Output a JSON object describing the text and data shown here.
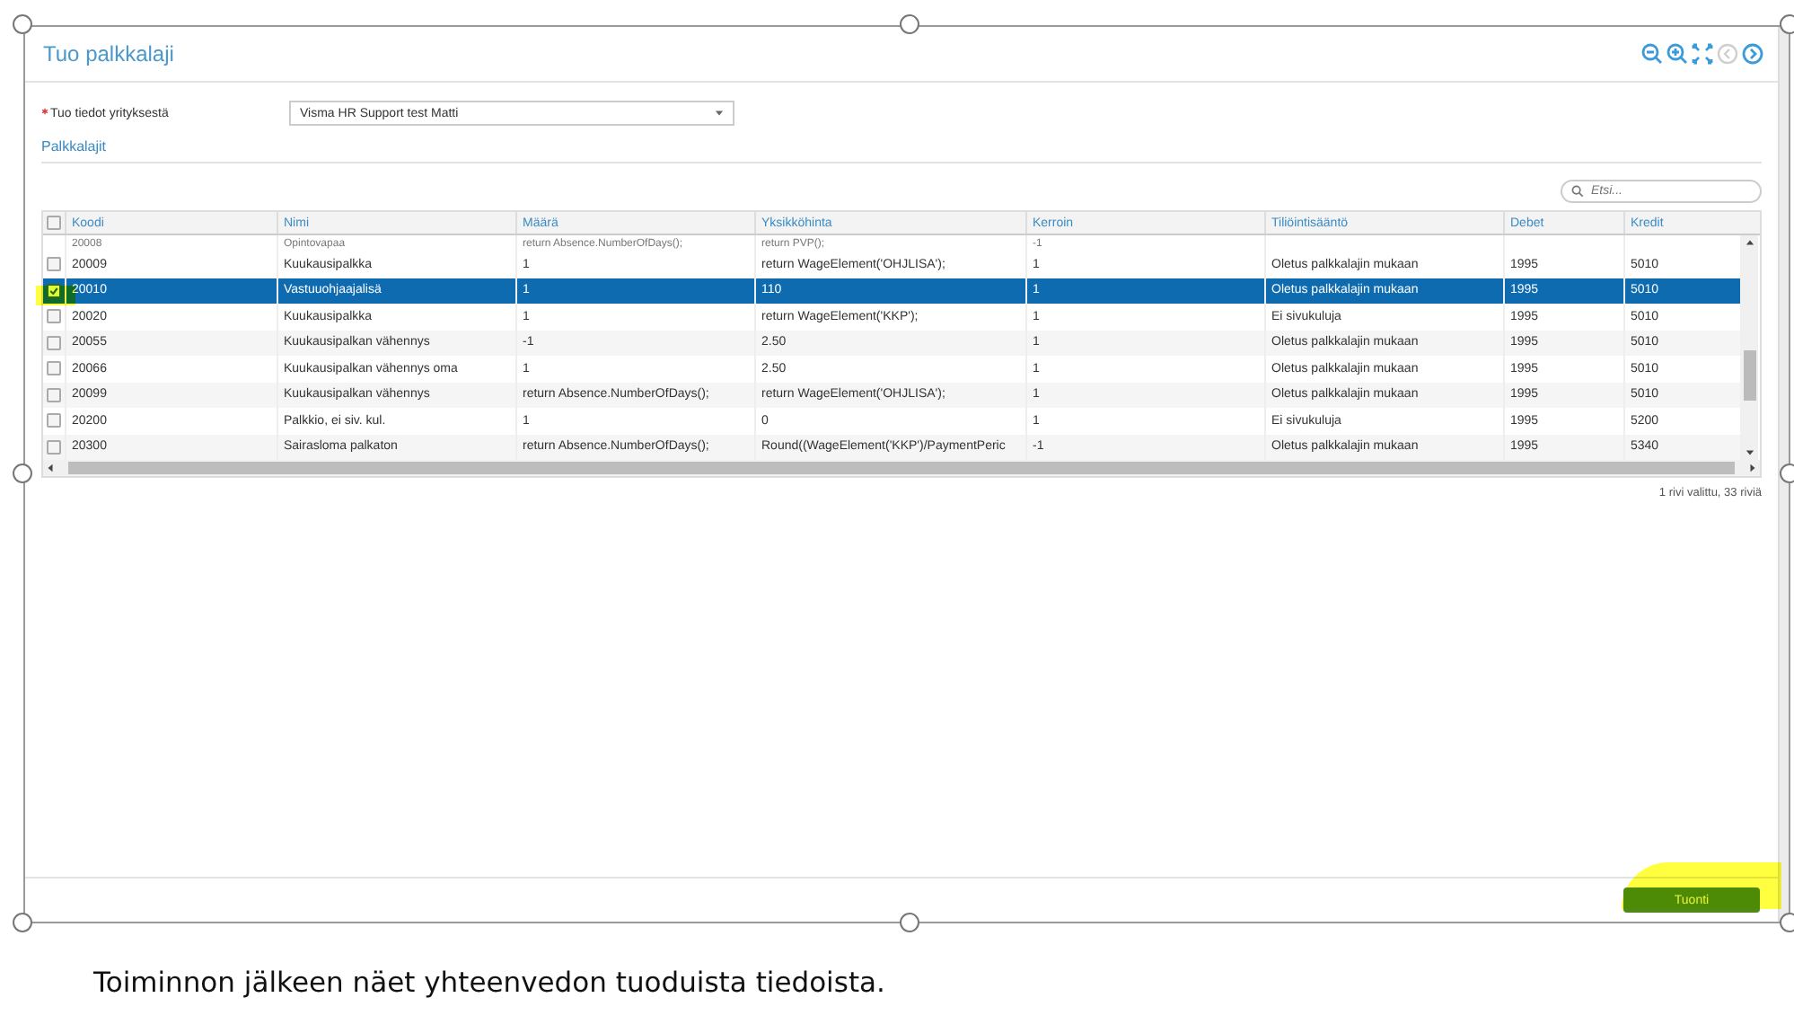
{
  "window": {
    "title": "Tuo palkkalaji"
  },
  "pager": {
    "previous_disabled": true,
    "next_disabled": false
  },
  "source_field": {
    "label": "Tuo tiedot yrityksestä",
    "required": true,
    "value": "Visma HR Support test Matti"
  },
  "section_title": "Palkkalajit",
  "search": {
    "placeholder": "Etsi..."
  },
  "table": {
    "all_checked": false,
    "columns": [
      "Koodi",
      "Nimi",
      "Määrä",
      "Yksikköhinta",
      "Kerroin",
      "Tiliöintisääntö",
      "Debet",
      "Kredit"
    ],
    "partial_row": {
      "cells": [
        "20008",
        "Opintovapaa",
        "return Absence.NumberOfDays();",
        "return PVP();",
        "-1",
        "",
        "",
        ""
      ]
    },
    "rows": [
      {
        "checked": false,
        "selected": false,
        "cells": [
          "20009",
          "Kuukausipalkka",
          "1",
          "return WageElement('OHJLISA');",
          "1",
          "Oletus palkkalajin mukaan",
          "1995",
          "5010"
        ]
      },
      {
        "checked": true,
        "selected": true,
        "cells": [
          "20010",
          "Vastuuohjaajalisä",
          "1",
          "110",
          "1",
          "Oletus palkkalajin mukaan",
          "1995",
          "5010"
        ]
      },
      {
        "checked": false,
        "selected": false,
        "cells": [
          "20020",
          "Kuukausipalkka",
          "1",
          "return WageElement('KKP');",
          "1",
          "Ei sivukuluja",
          "1995",
          "5010"
        ]
      },
      {
        "checked": false,
        "selected": false,
        "cells": [
          "20055",
          "Kuukausipalkan vähennys",
          "-1",
          "2.50",
          "1",
          "Oletus palkkalajin mukaan",
          "1995",
          "5010"
        ]
      },
      {
        "checked": false,
        "selected": false,
        "cells": [
          "20066",
          "Kuukausipalkan vähennys oma",
          "1",
          "2.50",
          "1",
          "Oletus palkkalajin mukaan",
          "1995",
          "5010"
        ]
      },
      {
        "checked": false,
        "selected": false,
        "cells": [
          "20099",
          "Kuukausipalkan vähennys",
          "return Absence.NumberOfDays();",
          "return WageElement('OHJLISA');",
          "1",
          "Oletus palkkalajin mukaan",
          "1995",
          "5010"
        ]
      },
      {
        "checked": false,
        "selected": false,
        "cells": [
          "20200",
          "Palkkio, ei siv. kul.",
          "1",
          "0",
          "1",
          "Ei sivukuluja",
          "1995",
          "5200"
        ]
      },
      {
        "checked": false,
        "selected": false,
        "cells": [
          "20300",
          "Sairasloma palkaton",
          "return Absence.NumberOfDays();",
          "Round((WageElement('KKP')/PaymentPeric",
          "-1",
          "Oletus palkkalajin mukaan",
          "1995",
          "5340"
        ]
      }
    ]
  },
  "status": "1 rivi valittu, 33 riviä",
  "buttons": [
    {
      "label": "Tuonti"
    }
  ],
  "caption": "Toiminnon jälkeen näet yhteenvedon tuoduista tiedoista."
}
